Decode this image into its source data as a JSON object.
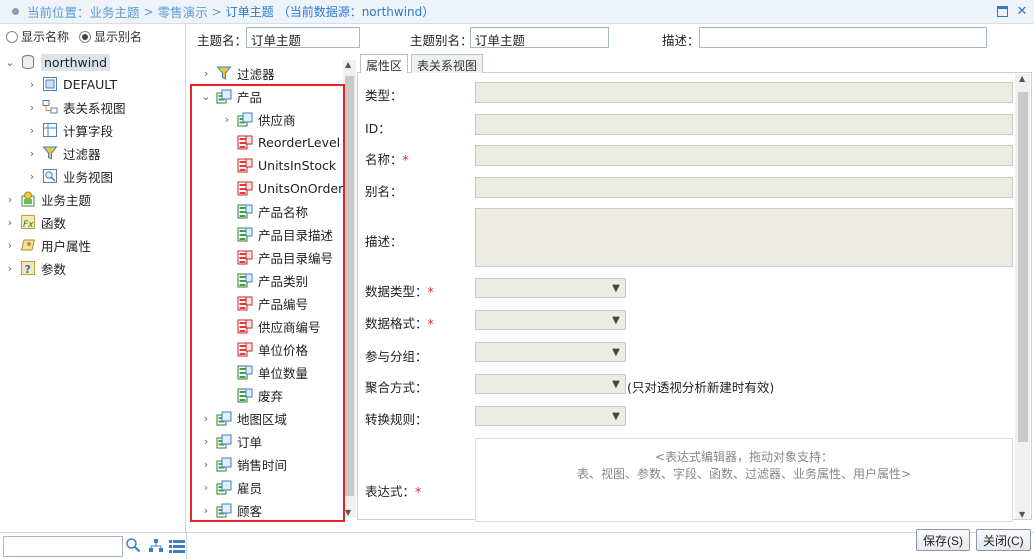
{
  "titlebar": {
    "label_current": "当前位置：",
    "crumb1": "业务主题",
    "crumb2": "零售演示",
    "crumb3": "订单主题",
    "datasource": "（当前数据源：northwind）",
    "sep": ">"
  },
  "left": {
    "radio_name": "显示名称",
    "radio_alias": "显示别名",
    "tree": {
      "root": "northwind",
      "default": "DEFAULT",
      "relation_view": "表关系视图",
      "calc_field": "计算字段",
      "filter": "过滤器",
      "biz_view": "业务视图",
      "biz_topic": "业务主题",
      "function": "函数",
      "user_attr": "用户属性",
      "param": "参数"
    }
  },
  "header": {
    "topic_name_label": "主题名：",
    "topic_name_value": "订单主题",
    "topic_alias_label": "主题别名：",
    "topic_alias_value": "订单主题",
    "desc_label": "描述：",
    "desc_value": ""
  },
  "middle": {
    "filter": "过滤器",
    "product": "产品",
    "supplier": "供应商",
    "fields": [
      "ReorderLevel",
      "UnitsInStock",
      "UnitsOnOrder",
      "产品名称",
      "产品目录描述",
      "产品目录编号",
      "产品类别",
      "产品编号",
      "供应商编号",
      "单位价格",
      "单位数量",
      "废弃"
    ],
    "map_region": "地图区域",
    "order": "订单",
    "sales_time": "销售时间",
    "employee": "雇员",
    "customer": "顾客"
  },
  "tabs": {
    "props": "属性区",
    "relation": "表关系视图"
  },
  "props": {
    "type": "类型：",
    "id": "ID：",
    "name": "名称：",
    "alias": "别名：",
    "desc": "描述：",
    "data_type": "数据类型：",
    "data_format": "数据格式：",
    "grouping": "参与分组：",
    "agg": "聚合方式：",
    "agg_note": "(只对透视分析新建时有效)",
    "convert": "转换规则：",
    "expr": "表达式：",
    "required": "*",
    "expr_hint1": "<表达式编辑器，拖动对象支持：",
    "expr_hint2": "表、视图、参数、字段、函数、过滤器、业务属性、用户属性>"
  },
  "buttons": {
    "save": "保存(S)",
    "close": "关闭(C)"
  }
}
